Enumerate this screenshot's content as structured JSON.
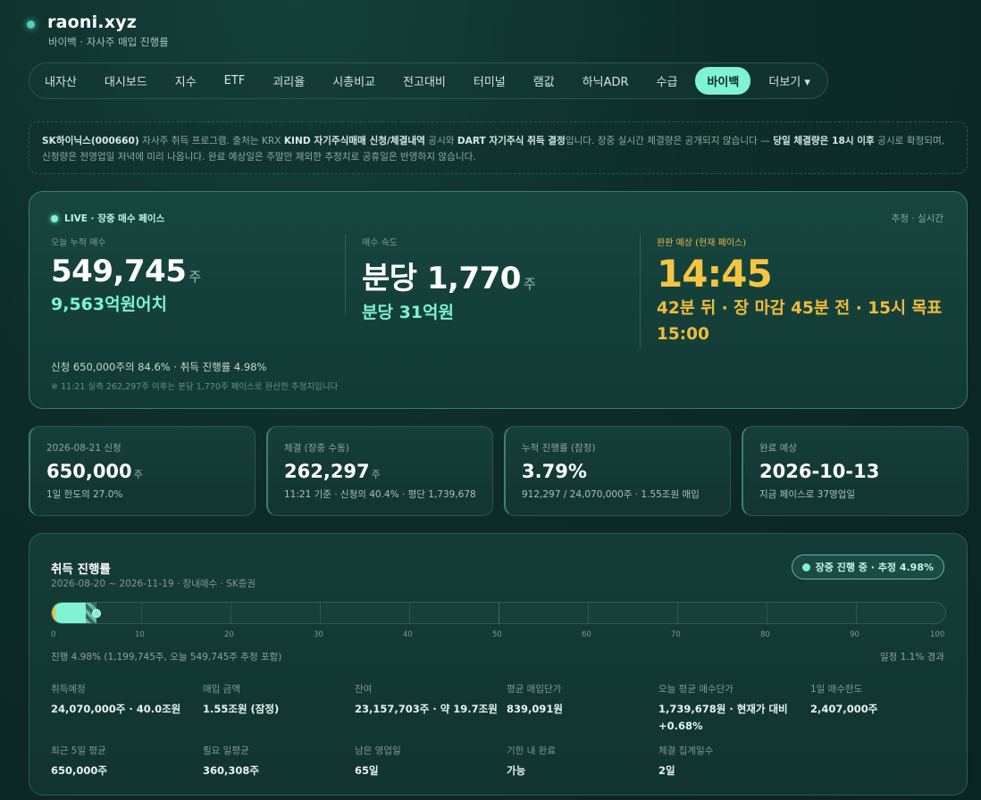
{
  "header": {
    "brand": "raoni.xyz",
    "subtitle": "바이백 · 자사주 매입 진행률"
  },
  "nav": {
    "items": [
      "내자산",
      "대시보드",
      "지수",
      "ETF",
      "괴리율",
      "시총비교",
      "전고대비",
      "터미널",
      "램값",
      "하닉ADR",
      "수급",
      "바이백"
    ],
    "active": "바이백",
    "more_label": "더보기 ▾"
  },
  "notice": {
    "p1": "SK하이닉스(000660)",
    "p2": " 자사주 취득 프로그램. 출처는 KRX ",
    "p3": "KIND 자기주식매매 신청/체결내역",
    "p4": " 공시와 ",
    "p5": "DART 자기주식 취득 결정",
    "p6": "입니다. 장중 실시간 체결량은 공개되지 않습니다 — ",
    "p7": "당일 체결량은 18시 이후",
    "p8": " 공시로 확정되며, 신청량은 전영업일 저녁에 미리 나옵니다. 완료 예상일은 주말만 제외한 추정치로 공휴일은 반영하지 않습니다."
  },
  "live": {
    "tag": "LIVE · 장중 매수 페이스",
    "right_label": "추정 · 실시간",
    "today": {
      "label": "오늘 누적 매수",
      "value": "549,745",
      "unit": "주",
      "sub": "9,563억원어치"
    },
    "speed": {
      "label": "매수 속도",
      "value": "분당 1,770",
      "unit": "주",
      "sub": "분당 31억원"
    },
    "eta": {
      "label": "완판 예상 (현재 페이스)",
      "value": "14:45",
      "sub": "42분 뒤 · 장 마감 45분 전 · 15시 목표 15:00"
    },
    "summary": "신청 650,000주의 84.6% · 취득 진행률 4.98%",
    "note": "※ 11:21 실측 262,297주 이후는 분당 1,770주 페이스로 환산한 추정치입니다"
  },
  "stats": [
    {
      "label": "2026-08-21 신청",
      "value": "650,000",
      "unit": "주",
      "sub": "1일 한도의 27.0%"
    },
    {
      "label": "체결 (장중 수동)",
      "value": "262,297",
      "unit": "주",
      "sub": "11:21 기준 · 신청의 40.4% · 평단 1,739,678"
    },
    {
      "label": "누적 진행률 (잠정)",
      "value": "3.79%",
      "unit": "",
      "sub": "912,297 / 24,070,000주 · 1.55조원 매입"
    },
    {
      "label": "완료 예상",
      "value": "2026-10-13",
      "unit": "",
      "sub": "지금 페이스로 37영업일"
    }
  ],
  "progress": {
    "title": "취득 진행률",
    "period": "2026-08-20 ~ 2026-11-19 · 장내매수 · SK증권",
    "badge": "장중 진행 중 · 추정 4.98%",
    "done_pct": 3.79,
    "estimated_pct": 4.98,
    "axis_labels": [
      "0",
      "10",
      "20",
      "30",
      "40",
      "50",
      "60",
      "70",
      "80",
      "90",
      "100"
    ],
    "note_left": "진행 4.98% (1,199,745주, 오늘 549,745주 추정 포함)",
    "note_right": "일정 1.1% 경과",
    "details": [
      {
        "label": "취득예정",
        "value": "24,070,000주 · 40.0조원"
      },
      {
        "label": "매입 금액",
        "value": "1.55조원 (잠정)"
      },
      {
        "label": "잔여",
        "value": "23,157,703주 · 약 19.7조원"
      },
      {
        "label": "평균 매입단가",
        "value": "839,091원"
      },
      {
        "label": "오늘 평균 매수단가",
        "value": "1,739,678원 · 현재가 대비 +0.68%"
      },
      {
        "label": "1일 매수한도",
        "value": "2,407,000주"
      },
      {
        "label": "최근 5일 평균",
        "value": "650,000주"
      },
      {
        "label": "필요 일평균",
        "value": "360,308주"
      },
      {
        "label": "남은 영업일",
        "value": "65일"
      },
      {
        "label": "기한 내 완료",
        "value": "가능"
      },
      {
        "label": "체결 집계일수",
        "value": "2일"
      }
    ]
  },
  "colors": {
    "accent": "#7ff3d2",
    "gold": "#f5c542",
    "background": "#0d2c29"
  }
}
